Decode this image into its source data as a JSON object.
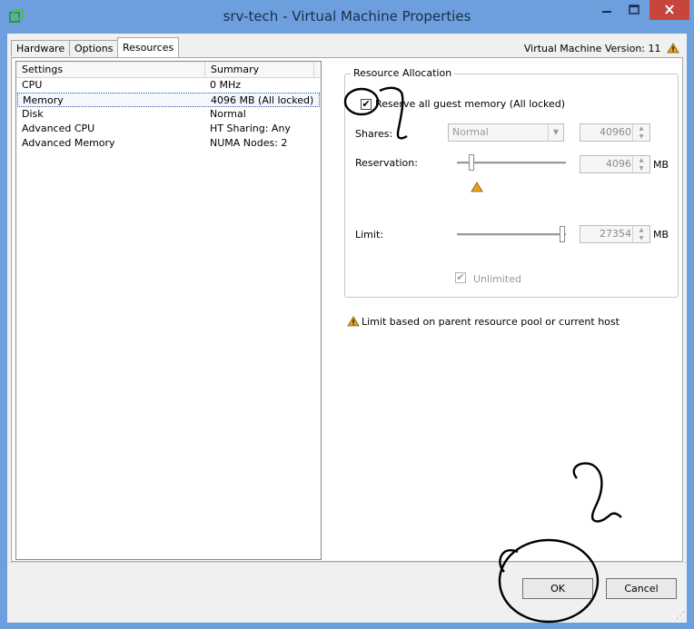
{
  "window": {
    "title": "srv-tech - Virtual Machine Properties",
    "app_icon": "vsphere-vm-icon",
    "controls": {
      "minimize": "minimize-icon",
      "maximize": "maximize-icon",
      "close": "close-icon"
    }
  },
  "tabs": [
    {
      "label": "Hardware",
      "active": false
    },
    {
      "label": "Options",
      "active": false
    },
    {
      "label": "Resources",
      "active": true
    }
  ],
  "vm_version": "Virtual Machine Version: 11",
  "settings": {
    "headers": {
      "settings": "Settings",
      "summary": "Summary"
    },
    "rows": [
      {
        "name": "CPU",
        "summary": "0 MHz",
        "selected": false
      },
      {
        "name": "Memory",
        "summary": "4096 MB (All locked)",
        "selected": true
      },
      {
        "name": "Disk",
        "summary": "Normal",
        "selected": false
      },
      {
        "name": "Advanced CPU",
        "summary": "HT Sharing: Any",
        "selected": false
      },
      {
        "name": "Advanced Memory",
        "summary": "NUMA Nodes: 2",
        "selected": false
      }
    ]
  },
  "resource_allocation": {
    "legend": "Resource Allocation",
    "reserve_all": {
      "label": "Reserve all guest memory (All locked)",
      "checked": true
    },
    "shares": {
      "label": "Shares:",
      "selected": "Normal",
      "value": "40960"
    },
    "reservation": {
      "label": "Reservation:",
      "value": "4096",
      "unit": "MB",
      "slider_fraction": 0.13
    },
    "limit": {
      "label": "Limit:",
      "value": "27354",
      "unit": "MB",
      "slider_fraction": 0.97
    },
    "unlimited": {
      "label": "Unlimited",
      "checked": true,
      "disabled": true
    }
  },
  "note": "Limit based on parent resource pool or current host",
  "buttons": {
    "ok": "OK",
    "cancel": "Cancel"
  },
  "colors": {
    "titlebar": "#6d9edd",
    "close": "#c7463c",
    "warning": "#e8a317",
    "annotation": "#000000"
  }
}
